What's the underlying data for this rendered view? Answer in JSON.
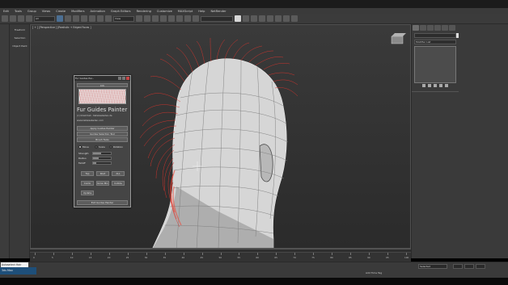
{
  "app": {
    "menu": [
      "Edit",
      "Tools",
      "Group",
      "Views",
      "Create",
      "Modifiers",
      "Animation",
      "Graph Editors",
      "Rendering",
      "Customize",
      "MAXScript",
      "Help",
      "NetRender"
    ],
    "toolbar_select": "All",
    "toolbar_select2": "View"
  },
  "command_panel_left": {
    "buttons": [
      "Freeform",
      "Selection",
      "Object Paint"
    ]
  },
  "viewport": {
    "label": "[ + ] [Perspective ] [Realistic + Edged Faces ]"
  },
  "plugin": {
    "title": "Fur Guides Pai...",
    "header": "Info",
    "name": "Fur Guides Painter",
    "copyright": "(c) Orest Kall - Kallwiesbaden.de",
    "url": "www.kallwiesbaden.com",
    "btn_apply": "Apply Guides Painter",
    "btn_select": "Guides Selection Tool",
    "btn_brush": "Brush Tools",
    "radio_labels": [
      "Move",
      "Scale",
      "Rotation"
    ],
    "slider_labels": [
      "Strength",
      "Radius",
      "Falloff"
    ],
    "slider_levels": [
      0.45,
      0.3,
      0.2
    ],
    "btn_row1": [
      "Top",
      "Root",
      "ALL"
    ],
    "btn_row2": [
      "Comb",
      "Grow Mix",
      "Collide"
    ],
    "btn_single": "Update",
    "btn_exit": "Exit Guides Painter"
  },
  "right_panel": {
    "modifier_list": "Modifier List"
  },
  "timeline": {
    "ticks": [
      "0",
      "5",
      "10",
      "15",
      "20",
      "25",
      "30",
      "35",
      "40",
      "45",
      "50",
      "55",
      "60",
      "65",
      "70",
      "75",
      "80",
      "85",
      "90",
      "95",
      "100"
    ]
  },
  "status": {
    "script": "Autoselect Hair",
    "dock_items": [
      "3ds Max",
      "3ds Max"
    ],
    "add_time_tag": "Add Time Tag",
    "selection_set": "Selected"
  },
  "colors": {
    "accent": "#1e4f7a",
    "hair": "#e0342c",
    "viewport_bg": "#333333"
  }
}
